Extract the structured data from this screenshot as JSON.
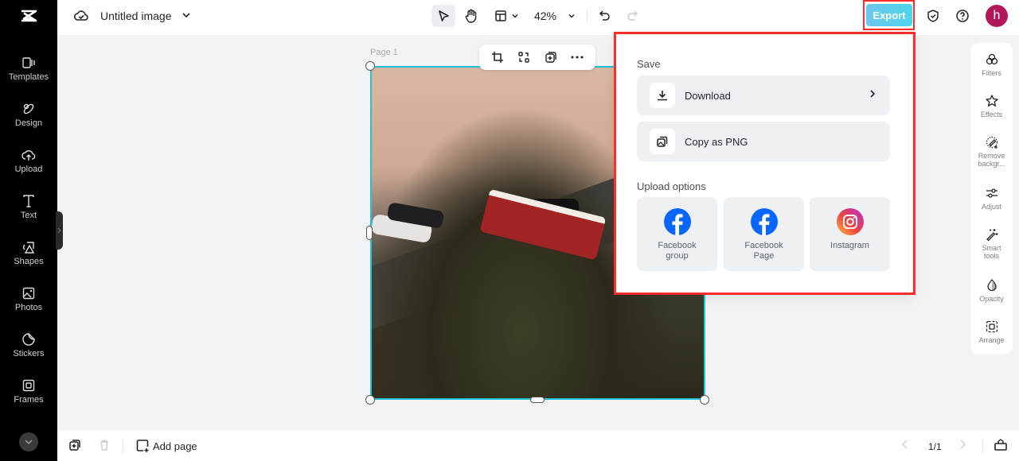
{
  "app": {
    "title": "Untitled image"
  },
  "sidebar": {
    "items": [
      {
        "label": "Templates",
        "icon": "templates-icon"
      },
      {
        "label": "Design",
        "icon": "design-icon"
      },
      {
        "label": "Upload",
        "icon": "upload-icon"
      },
      {
        "label": "Text",
        "icon": "text-icon"
      },
      {
        "label": "Shapes",
        "icon": "shapes-icon"
      },
      {
        "label": "Photos",
        "icon": "photos-icon"
      },
      {
        "label": "Stickers",
        "icon": "stickers-icon"
      },
      {
        "label": "Frames",
        "icon": "frames-icon"
      }
    ]
  },
  "toolbar": {
    "zoom_level": "42%",
    "export_label": "Export",
    "avatar_initial": "h"
  },
  "canvas": {
    "page_label": "Page 1"
  },
  "export_panel": {
    "save_label": "Save",
    "download_label": "Download",
    "copy_label": "Copy as PNG",
    "upload_label": "Upload options",
    "upload_options": [
      {
        "label": "Facebook group",
        "icon": "facebook-icon"
      },
      {
        "label": "Facebook Page",
        "icon": "facebook-icon"
      },
      {
        "label": "Instagram",
        "icon": "instagram-icon"
      }
    ],
    "colors": {
      "facebook": "#0866ff",
      "highlight_border": "#ff2d2d"
    }
  },
  "right_panel": {
    "items": [
      {
        "label": "Filters"
      },
      {
        "label": "Effects"
      },
      {
        "label": "Remove backgr..."
      },
      {
        "label": "Adjust"
      },
      {
        "label": "Smart tools"
      },
      {
        "label": "Opacity"
      },
      {
        "label": "Arrange"
      }
    ]
  },
  "bottom": {
    "add_page_label": "Add page",
    "page_count": "1/1"
  }
}
